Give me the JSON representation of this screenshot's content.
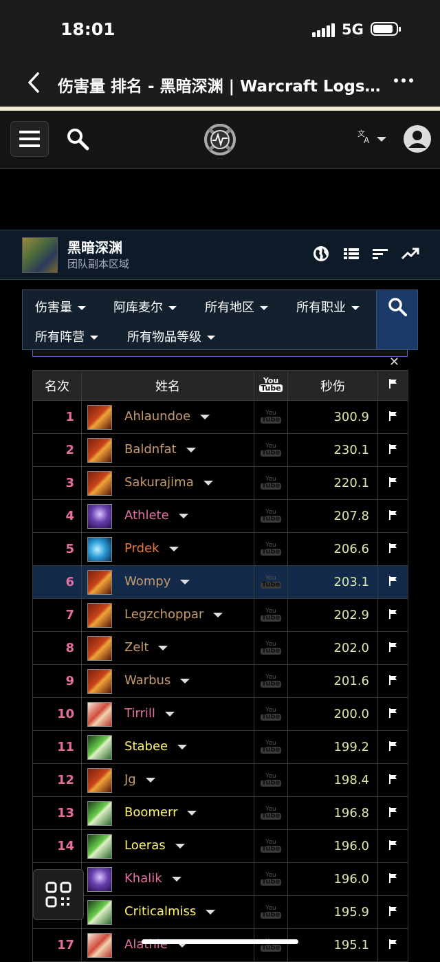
{
  "status_bar": {
    "time": "18:01",
    "network": "5G"
  },
  "nav": {
    "title": "伤害量 排名 - 黑暗深渊 | Warcraft Logs V..."
  },
  "zone": {
    "name": "黑暗深渊",
    "subtitle": "团队副本区域"
  },
  "filters": {
    "metric": "伤害量",
    "server": "阿库麦尔",
    "region": "所有地区",
    "class": "所有职业",
    "faction": "所有阵营",
    "item_level": "所有物品等级"
  },
  "table": {
    "headers": {
      "rank": "名次",
      "name": "姓名",
      "video": "You Tube",
      "dps": "秒伤"
    },
    "youtube_label": {
      "top": "You",
      "bottom": "Tube"
    },
    "rows": [
      {
        "rank": "1",
        "name": "Ahlaundoe",
        "dps": "300.9",
        "spec": "warrior",
        "name_color": "#c69b6d"
      },
      {
        "rank": "2",
        "name": "Baldnfat",
        "dps": "230.1",
        "spec": "warrior",
        "name_color": "#c69b6d"
      },
      {
        "rank": "3",
        "name": "Sakurajima",
        "dps": "220.1",
        "spec": "warrior",
        "name_color": "#c69b6d"
      },
      {
        "rank": "4",
        "name": "Athlete",
        "dps": "207.8",
        "spec": "warlock",
        "name_color": "#e46fa0"
      },
      {
        "rank": "5",
        "name": "Prdek",
        "dps": "206.6",
        "spec": "mage",
        "name_color": "#e8773a"
      },
      {
        "rank": "6",
        "name": "Wompy",
        "dps": "203.1",
        "spec": "warrior",
        "name_color": "#c69b6d"
      },
      {
        "rank": "7",
        "name": "Legzchoppar",
        "dps": "202.9",
        "spec": "warrior",
        "name_color": "#c69b6d"
      },
      {
        "rank": "8",
        "name": "Zelt",
        "dps": "202.0",
        "spec": "warrior",
        "name_color": "#c69b6d"
      },
      {
        "rank": "9",
        "name": "Warbus",
        "dps": "201.6",
        "spec": "warrior",
        "name_color": "#c69b6d"
      },
      {
        "rank": "10",
        "name": "Tirrill",
        "dps": "200.0",
        "spec": "hunter",
        "name_color": "#e46fa0"
      },
      {
        "rank": "11",
        "name": "Stabee",
        "dps": "199.2",
        "spec": "rogue",
        "name_color": "#fff468"
      },
      {
        "rank": "12",
        "name": "Jg",
        "dps": "198.4",
        "spec": "warrior",
        "name_color": "#c69b6d"
      },
      {
        "rank": "13",
        "name": "Boomerr",
        "dps": "196.8",
        "spec": "rogue",
        "name_color": "#fff468"
      },
      {
        "rank": "14",
        "name": "Loeras",
        "dps": "196.0",
        "spec": "rogue",
        "name_color": "#fff468"
      },
      {
        "rank": "15",
        "name": "Khalik",
        "dps": "196.0",
        "spec": "warlock",
        "name_color": "#e46fa0"
      },
      {
        "rank": "16",
        "name": "Criticalmiss",
        "dps": "195.9",
        "spec": "rogue",
        "name_color": "#fff468"
      },
      {
        "rank": "17",
        "name": "Alathie",
        "dps": "195.1",
        "spec": "hunter",
        "name_color": "#e46fa0"
      }
    ],
    "highlight_row": "6"
  },
  "colors": {
    "rank": "#e46fa0",
    "dps": "#d8e7a8",
    "highlight_bg": "#132a4a",
    "zone_bg": "#0d1a28",
    "filter_search_bg": "#1a3a6a"
  },
  "icons": [
    "back-icon",
    "more-icon",
    "menu-icon",
    "search-icon",
    "site-logo",
    "language-icon",
    "user-avatar-icon",
    "globe-icon",
    "list-icon",
    "sort-icon",
    "trend-icon",
    "close-icon",
    "youtube-icon",
    "flag-icon",
    "qr-code-icon"
  ]
}
